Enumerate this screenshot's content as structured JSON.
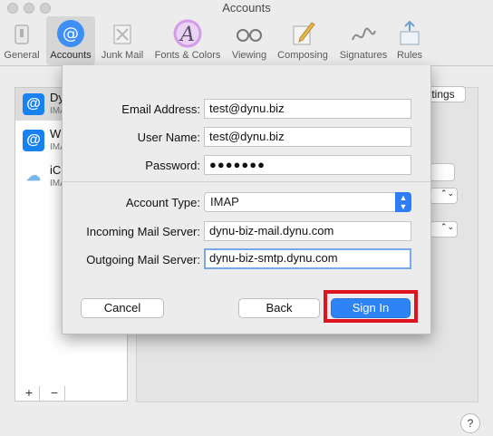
{
  "window": {
    "title": "Accounts"
  },
  "toolbar": {
    "items": [
      {
        "label": "General"
      },
      {
        "label": "Accounts"
      },
      {
        "label": "Junk Mail"
      },
      {
        "label": "Fonts & Colors"
      },
      {
        "label": "Viewing"
      },
      {
        "label": "Composing"
      },
      {
        "label": "Signatures"
      },
      {
        "label": "Rules"
      }
    ],
    "selected": "Accounts"
  },
  "sidebar": {
    "accounts": [
      {
        "name": "Dy",
        "sub": "IMA"
      },
      {
        "name": "Wh",
        "sub": "IMA"
      },
      {
        "name": "iCl",
        "sub": "IMA"
      }
    ],
    "add_label": "+",
    "remove_label": "−"
  },
  "background": {
    "settings_button_fragment": "ttings"
  },
  "dialog": {
    "email_label": "Email Address:",
    "email_value": "test@dynu.biz",
    "username_label": "User Name:",
    "username_value": "test@dynu.biz",
    "password_label": "Password:",
    "password_value": "●●●●●●●",
    "account_type_label": "Account Type:",
    "account_type_value": "IMAP",
    "incoming_label": "Incoming Mail Server:",
    "incoming_value": "dynu-biz-mail.dynu.com",
    "outgoing_label": "Outgoing Mail Server:",
    "outgoing_value": "dynu-biz-smtp.dynu.com",
    "cancel_label": "Cancel",
    "back_label": "Back",
    "signin_label": "Sign In"
  },
  "help_label": "?",
  "colors": {
    "accent": "#2e84f5",
    "highlight": "#e0141f"
  }
}
